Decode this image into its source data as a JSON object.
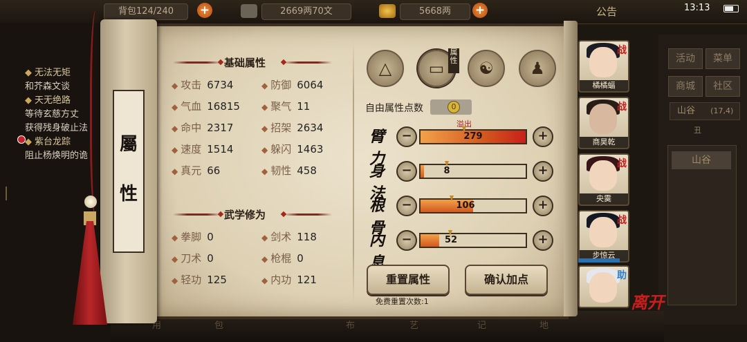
{
  "top_bar": {
    "resource_1": "背包124/240",
    "resource_2": "2669两70文",
    "resource_3": "5668两",
    "notice": "公告",
    "time": "13:13"
  },
  "quest_log": [
    {
      "title": "无法无矩",
      "desc": "和芥森文谈"
    },
    {
      "title": "天无绝路",
      "desc": "等待玄慈方丈"
    },
    {
      "title": "",
      "desc": "获得残身破止法"
    },
    {
      "title": "紫台龙踪",
      "desc": "阻止杨焕明的诡"
    }
  ],
  "right_panel": {
    "buttons": [
      "活动",
      "菜单",
      "商城",
      "社区"
    ],
    "location": "山谷",
    "coords": "(17,4)",
    "time_label": "丑",
    "map_button": "山谷"
  },
  "bottom_bar": [
    "用",
    "包",
    "布",
    "艺",
    "记",
    "地"
  ],
  "scroll": {
    "label_top": "屬",
    "label_bottom": "性"
  },
  "basic": {
    "title": "基础属性",
    "stats": [
      {
        "name": "攻击",
        "value": "6734"
      },
      {
        "name": "防御",
        "value": "6064"
      },
      {
        "name": "气血",
        "value": "16815"
      },
      {
        "name": "聚气",
        "value": "11"
      },
      {
        "name": "命中",
        "value": "2317"
      },
      {
        "name": "招架",
        "value": "2634"
      },
      {
        "name": "速度",
        "value": "1514"
      },
      {
        "name": "躲闪",
        "value": "1463"
      },
      {
        "name": "真元",
        "value": "66"
      },
      {
        "name": "韧性",
        "value": "458"
      }
    ]
  },
  "martial": {
    "title": "武学修为",
    "stats": [
      {
        "name": "拳脚",
        "value": "0"
      },
      {
        "name": "剑术",
        "value": "118"
      },
      {
        "name": "刀术",
        "value": "0"
      },
      {
        "name": "枪棍",
        "value": "0"
      },
      {
        "name": "轻功",
        "value": "125"
      },
      {
        "name": "内功",
        "value": "121"
      }
    ]
  },
  "tabs": {
    "attribute_tag": "属性",
    "icons": [
      "hat-icon",
      "scroll-tab-icon",
      "bagua-icon",
      "meridian-figure-icon"
    ]
  },
  "points": {
    "free_label": "自由属性点数",
    "free_value": "0",
    "overflow_label": "溢出",
    "attrs": [
      {
        "name": "臂力",
        "value": "279",
        "fill": 1.0
      },
      {
        "name": "身法",
        "value": "8",
        "fill": 0.03
      },
      {
        "name": "根骨",
        "value": "106",
        "fill": 0.5
      },
      {
        "name": "内息",
        "value": "52",
        "fill": 0.18
      }
    ],
    "minus": "−",
    "plus": "+"
  },
  "actions": {
    "reset": "重置属性",
    "confirm": "确认加点",
    "reset_note": "免费重置次数:1"
  },
  "party": [
    {
      "name": "橘橘蝠",
      "tag": "战"
    },
    {
      "name": "商昊乾",
      "tag": "战"
    },
    {
      "name": "央霙",
      "tag": "战"
    },
    {
      "name": "步惊云",
      "tag": "战"
    },
    {
      "name": "",
      "tag": "助"
    }
  ],
  "leave_label": "离开",
  "colors": {
    "accent_red": "#c81e1e",
    "bar_orange": "#e07a2e",
    "overflow_red": "#c8201a"
  }
}
